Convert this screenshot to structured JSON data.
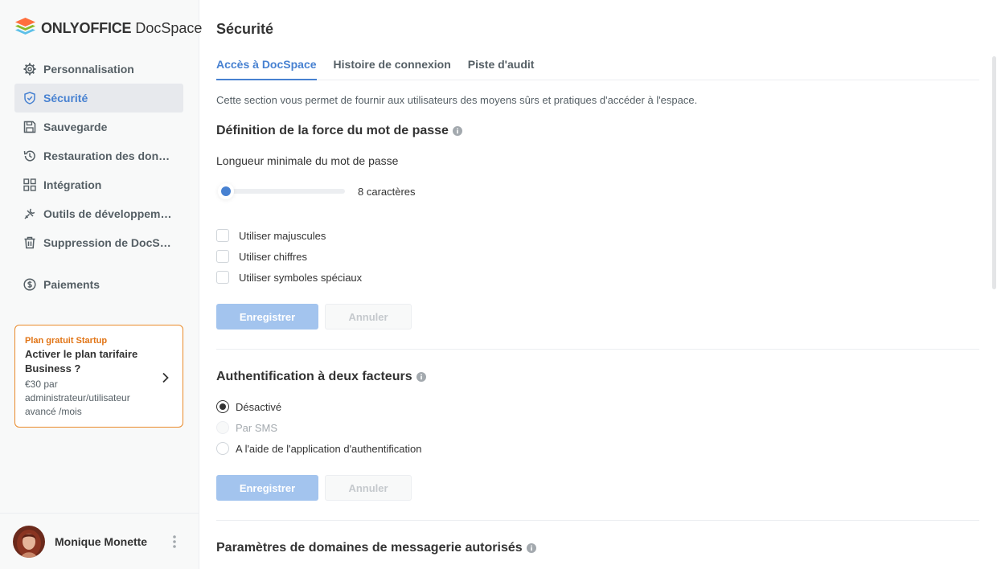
{
  "app": {
    "logo_bold": "ONLYOFFICE",
    "logo_light": "DocSpace"
  },
  "sidebar": {
    "items": [
      {
        "label": "Personnalisation",
        "icon": "gear-icon",
        "active": false
      },
      {
        "label": "Sécurité",
        "icon": "shield-icon",
        "active": true
      },
      {
        "label": "Sauvegarde",
        "icon": "floppy-icon",
        "active": false
      },
      {
        "label": "Restauration des données",
        "icon": "history-icon",
        "active": false
      },
      {
        "label": "Intégration",
        "icon": "grid-icon",
        "active": false
      },
      {
        "label": "Outils de développement",
        "icon": "tools-icon",
        "active": false
      },
      {
        "label": "Suppression de DocSpace",
        "icon": "trash-icon",
        "active": false
      },
      {
        "label": "Paiements",
        "icon": "coin-icon",
        "active": false
      }
    ],
    "promo": {
      "tag": "Plan gratuit Startup",
      "title": "Activer le plan tarifaire Business ?",
      "description": "€30 par administrateur/utilisateur avancé /mois"
    },
    "profile": {
      "name": "Monique Monette"
    }
  },
  "page": {
    "title": "Sécurité",
    "tabs": [
      {
        "label": "Accès à DocSpace",
        "active": true
      },
      {
        "label": "Histoire de connexion",
        "active": false
      },
      {
        "label": "Piste d'audit",
        "active": false
      }
    ],
    "intro": "Cette section vous permet de fournir aux utilisateurs des moyens sûrs et pratiques d'accéder à l'espace."
  },
  "password_strength": {
    "title": "Définition de la force du mot de passe",
    "subtitle": "Longueur minimale du mot de passe",
    "slider_value": 8,
    "slider_fraction": 0,
    "slider_label": "8 caractères",
    "options": [
      {
        "label": "Utiliser majuscules",
        "checked": false
      },
      {
        "label": "Utiliser chiffres",
        "checked": false
      },
      {
        "label": "Utiliser symboles spéciaux",
        "checked": false
      }
    ],
    "save_label": "Enregistrer",
    "cancel_label": "Annuler"
  },
  "two_factor": {
    "title": "Authentification à deux facteurs",
    "options": [
      {
        "label": "Désactivé",
        "selected": true,
        "disabled": false
      },
      {
        "label": "Par SMS",
        "selected": false,
        "disabled": true
      },
      {
        "label": "A l'aide de l'application d'authentification",
        "selected": false,
        "disabled": false
      }
    ],
    "save_label": "Enregistrer",
    "cancel_label": "Annuler"
  },
  "trusted_domains": {
    "title": "Paramètres de domaines de messagerie autorisés"
  },
  "colors": {
    "accent": "#4781d1",
    "promo_border": "#e98a2a",
    "promo_tag": "#e17415",
    "button_disabled": "#a3c4ee"
  }
}
